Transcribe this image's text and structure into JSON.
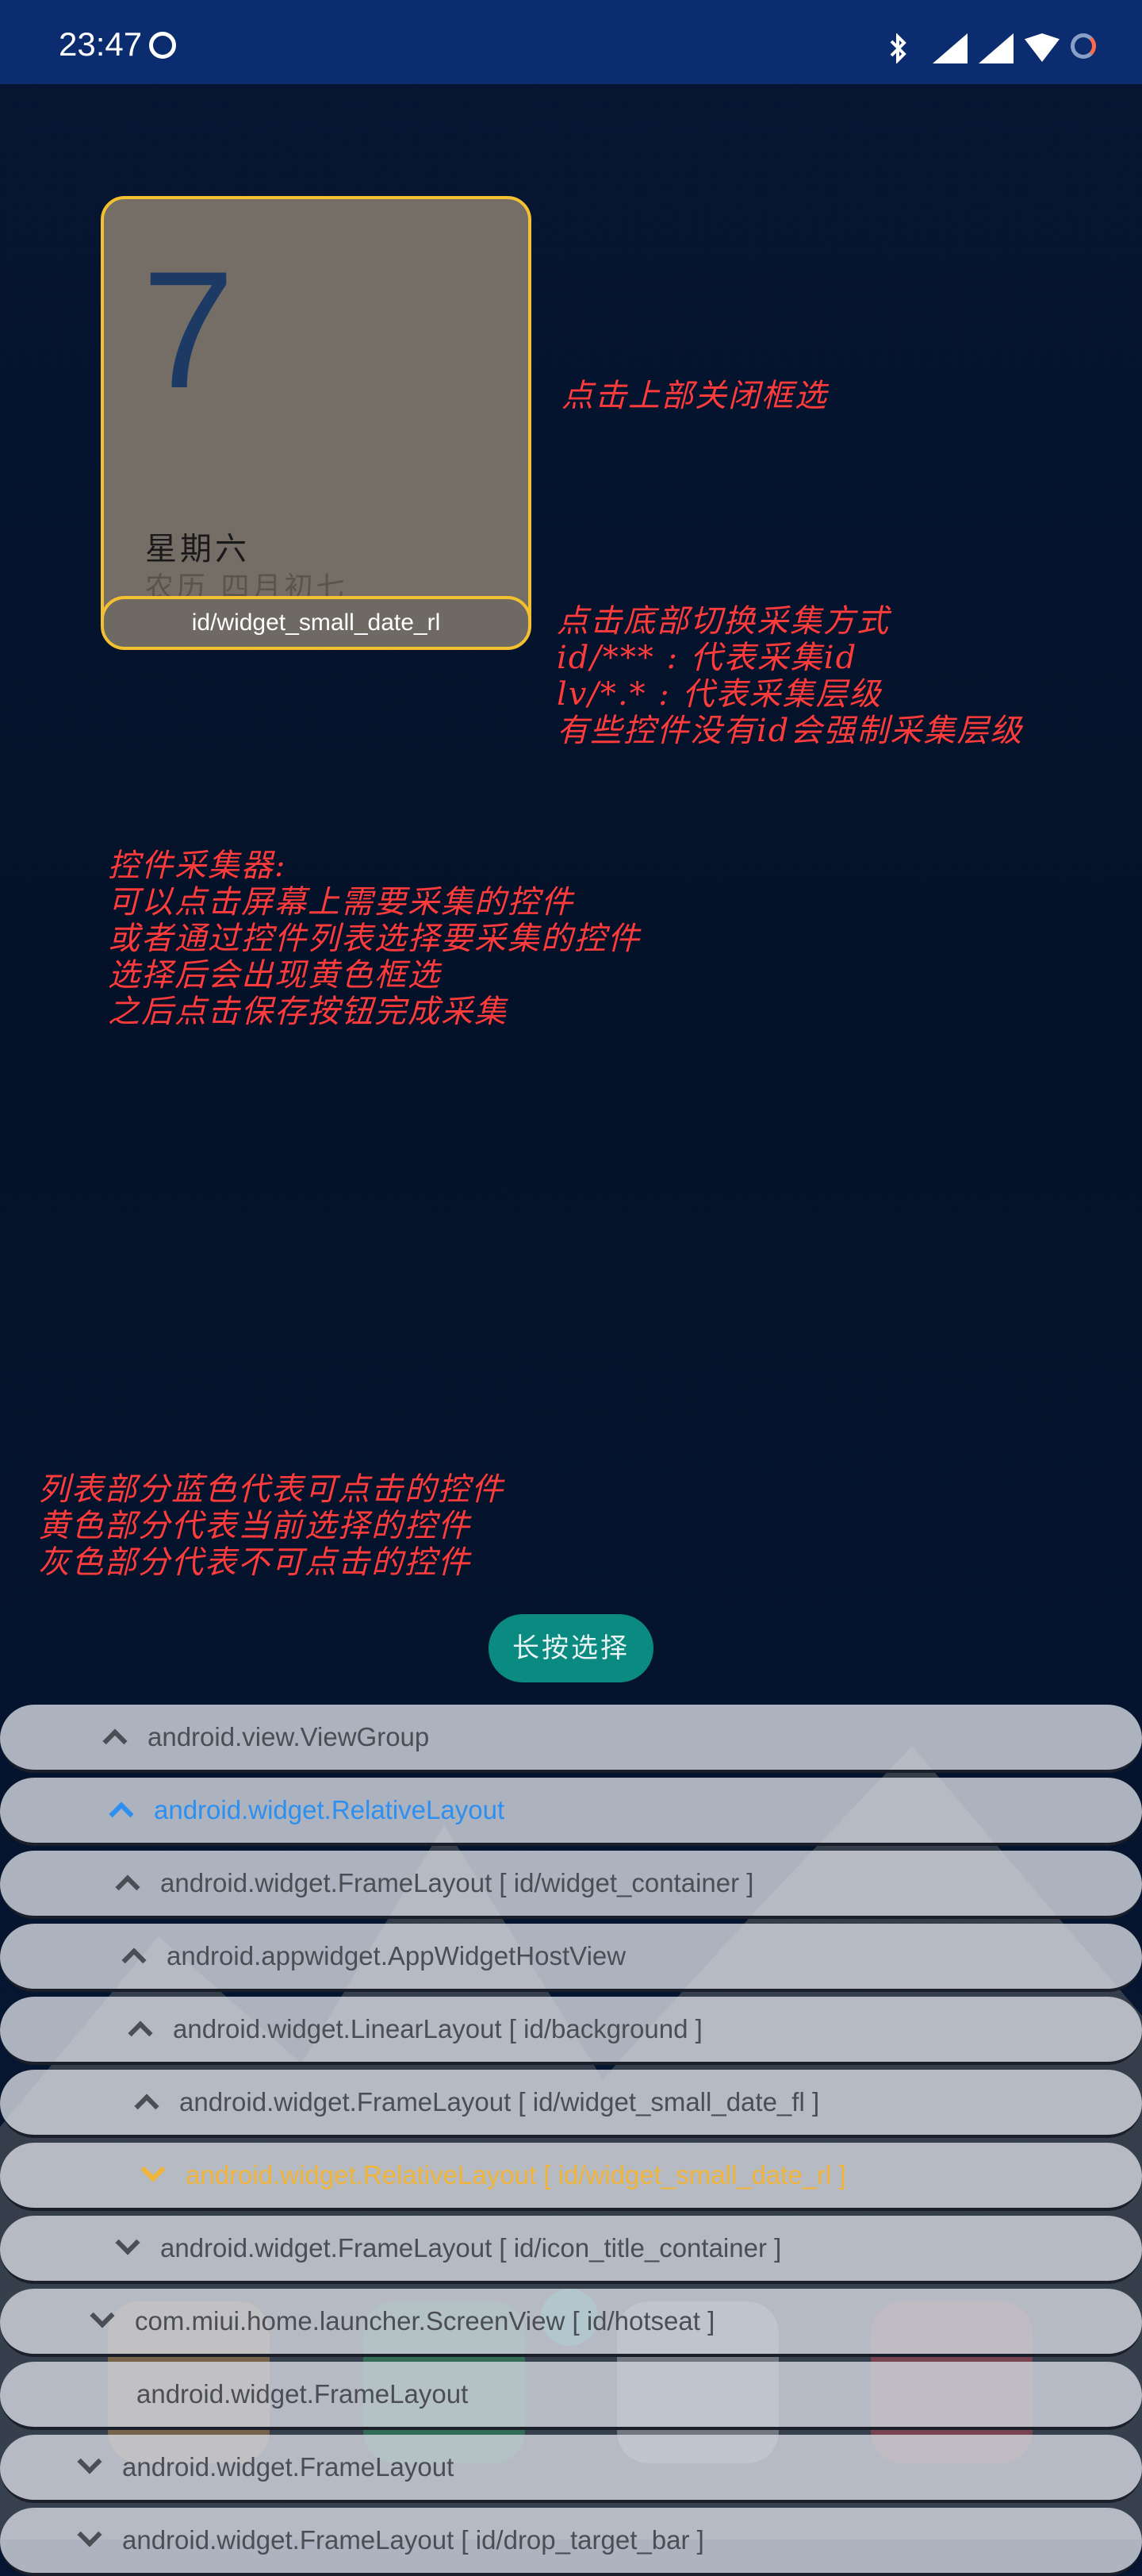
{
  "status_bar": {
    "time": "23:47"
  },
  "widget": {
    "day": "7",
    "weekday": "星期六",
    "lunar": "农历 四月初七",
    "id_label": "id/widget_small_date_rl"
  },
  "notes": {
    "close": "点击上部关闭框选",
    "mode": "点击底部切换采集方式\nid/*** : 代表采集id\nlv/*.* : 代表采集层级\n有些控件没有id会强制采集层级",
    "picker": "控件采集器:\n可以点击屏幕上需要采集的控件\n或者通过控件列表选择要采集的控件\n选择后会出现黄色框选\n之后点击保存按钮完成采集",
    "legend": "列表部分蓝色代表可点击的控件\n黄色部分代表当前选择的控件\n灰色部分代表不可点击的控件"
  },
  "long_press_button": "长按选择",
  "colors": {
    "selected": "#f0b43a",
    "clickable": "#2d8ff0",
    "unclickable": "#4b4e55",
    "frame": "#f2c030"
  },
  "tree": [
    {
      "text": "android.view.ViewGroup",
      "state": "gray",
      "chevron": "up"
    },
    {
      "text": "android.widget.RelativeLayout",
      "state": "blue",
      "chevron": "up"
    },
    {
      "text": "android.widget.FrameLayout [ id/widget_container ]",
      "state": "gray",
      "chevron": "up"
    },
    {
      "text": "android.appwidget.AppWidgetHostView",
      "state": "gray",
      "chevron": "up"
    },
    {
      "text": "android.widget.LinearLayout [ id/background ]",
      "state": "gray",
      "chevron": "up"
    },
    {
      "text": "android.widget.FrameLayout [ id/widget_small_date_fl ]",
      "state": "gray",
      "chevron": "up"
    },
    {
      "text": "android.widget.RelativeLayout [ id/widget_small_date_rl ]",
      "state": "sel",
      "chevron": "down"
    },
    {
      "text": "android.widget.FrameLayout [ id/icon_title_container ]",
      "state": "gray",
      "chevron": "down"
    },
    {
      "text": "com.miui.home.launcher.ScreenView [ id/hotseat ]",
      "state": "gray",
      "chevron": "down"
    },
    {
      "text": "android.widget.FrameLayout",
      "state": "gray",
      "chevron": "none"
    },
    {
      "text": "android.widget.FrameLayout",
      "state": "gray",
      "chevron": "down"
    },
    {
      "text": "android.widget.FrameLayout [ id/drop_target_bar ]",
      "state": "gray",
      "chevron": "down"
    }
  ]
}
